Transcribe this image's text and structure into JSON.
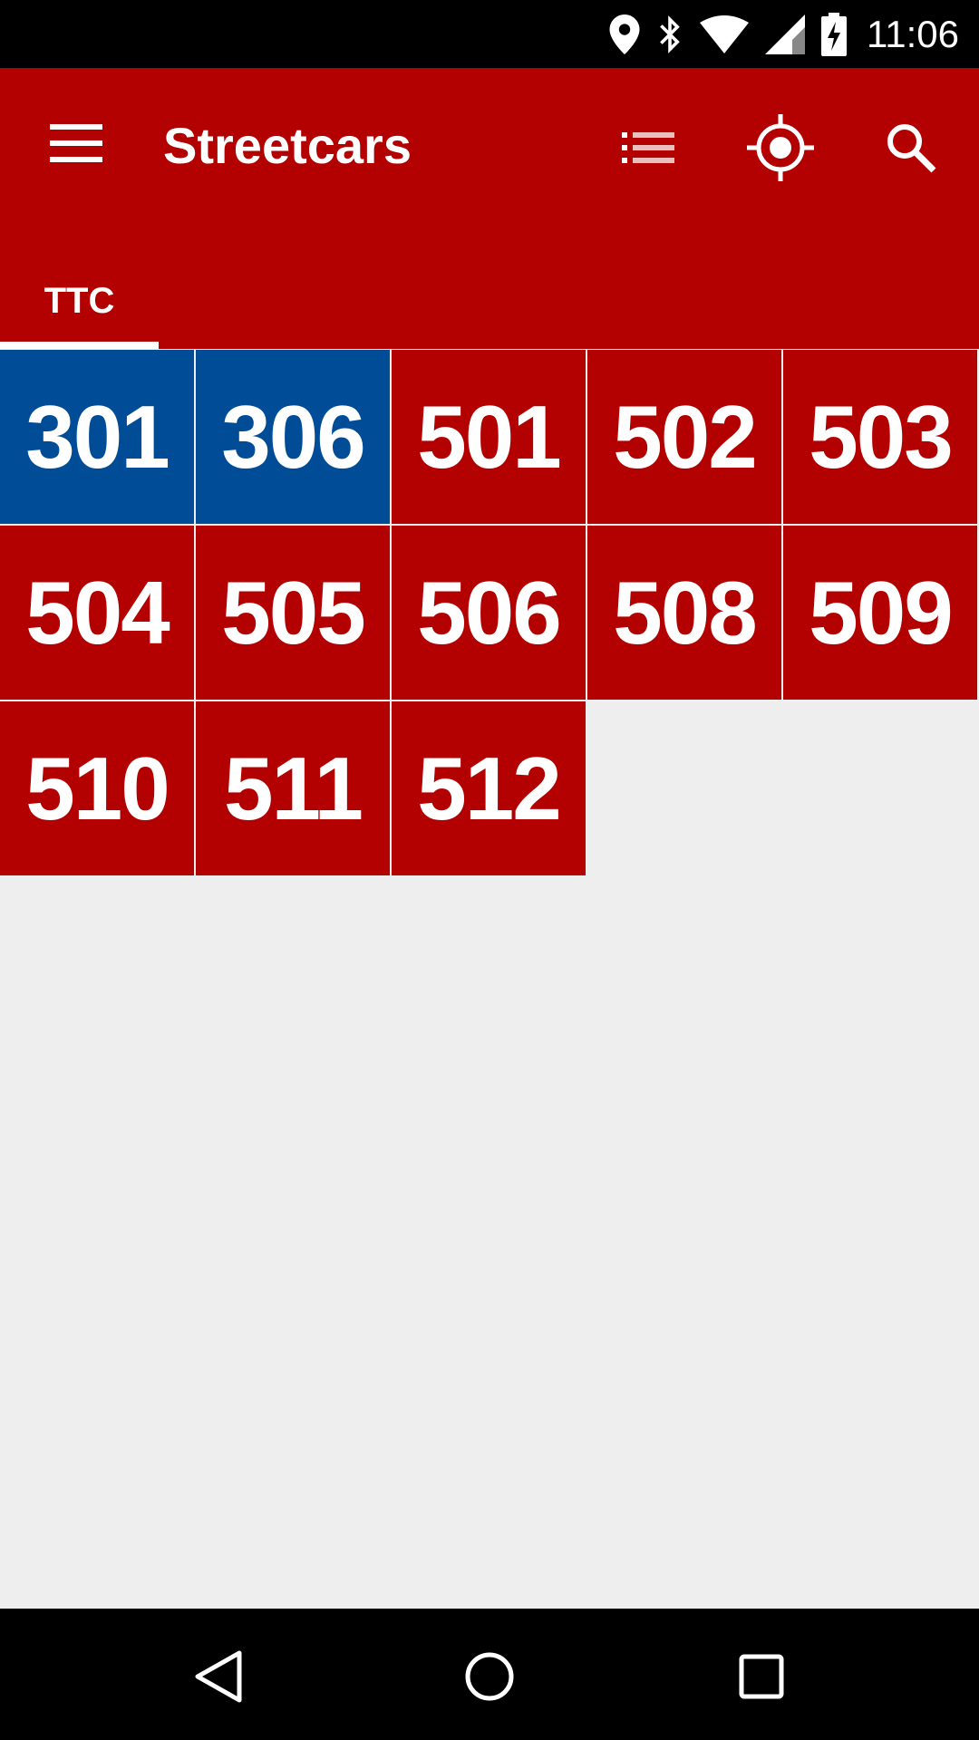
{
  "status_bar": {
    "time": "11:06",
    "icons": [
      "location-icon",
      "bluetooth-icon",
      "wifi-icon",
      "signal-icon",
      "battery-charging-icon"
    ]
  },
  "app_bar": {
    "title": "Streetcars",
    "menu_icon": "hamburger-menu-icon",
    "actions": [
      "list-view-icon",
      "my-location-icon",
      "search-icon"
    ]
  },
  "tabs": [
    {
      "label": "TTC",
      "selected": true
    }
  ],
  "routes": [
    {
      "number": "301",
      "color": "#004c97"
    },
    {
      "number": "306",
      "color": "#004c97"
    },
    {
      "number": "501",
      "color": "#b30000"
    },
    {
      "number": "502",
      "color": "#b30000"
    },
    {
      "number": "503",
      "color": "#b30000"
    },
    {
      "number": "504",
      "color": "#b30000"
    },
    {
      "number": "505",
      "color": "#b30000"
    },
    {
      "number": "506",
      "color": "#b30000"
    },
    {
      "number": "508",
      "color": "#b30000"
    },
    {
      "number": "509",
      "color": "#b30000"
    },
    {
      "number": "510",
      "color": "#b30000"
    },
    {
      "number": "511",
      "color": "#b30000"
    },
    {
      "number": "512",
      "color": "#b30000"
    }
  ],
  "nav_bar": {
    "buttons": [
      "back-icon",
      "home-icon",
      "recents-icon"
    ]
  },
  "colors": {
    "primary": "#b30000",
    "night_route": "#004c97",
    "background": "#eeeeee"
  }
}
